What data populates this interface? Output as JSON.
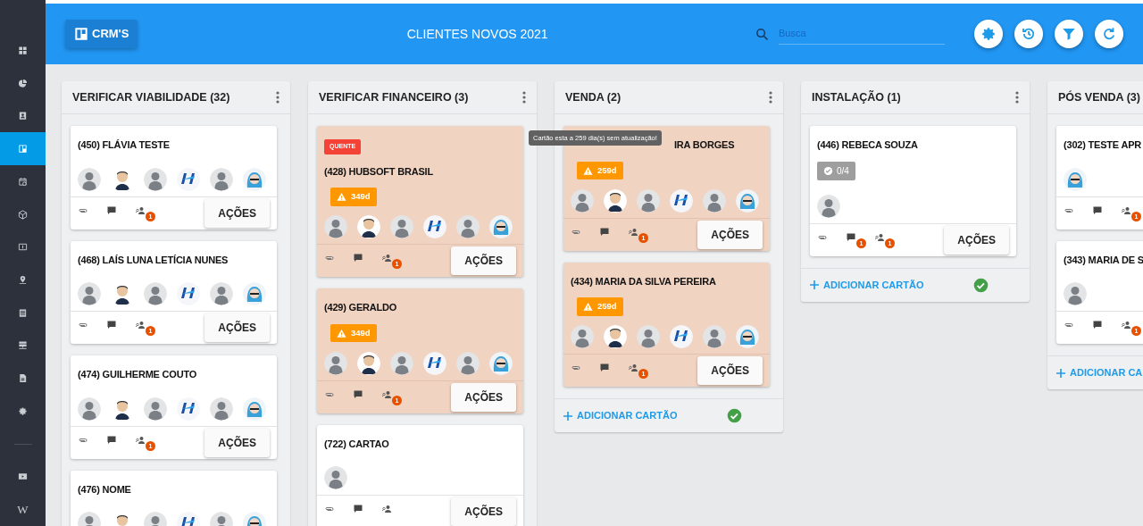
{
  "sidebar": {
    "items": [
      {
        "kind": "grid",
        "selected": false
      },
      {
        "kind": "pie",
        "selected": false
      },
      {
        "kind": "contact",
        "selected": false
      },
      {
        "kind": "board",
        "selected": true
      },
      {
        "kind": "calendar",
        "selected": false
      },
      {
        "kind": "cube",
        "selected": false
      },
      {
        "kind": "money",
        "selected": false
      },
      {
        "kind": "location",
        "selected": false
      },
      {
        "kind": "list",
        "selected": false
      },
      {
        "kind": "server",
        "selected": false
      },
      {
        "kind": "document",
        "selected": false
      },
      {
        "kind": "gear",
        "selected": false
      },
      {
        "kind": "divider"
      },
      {
        "kind": "video",
        "selected": false
      },
      {
        "kind": "letter",
        "text": "W",
        "selected": false
      }
    ]
  },
  "header": {
    "button": "CRM'S",
    "title": "CLIENTES NOVOS 2021",
    "search": {
      "placeholder": "Busca"
    },
    "actions": [
      {
        "kind": "settings"
      },
      {
        "kind": "history"
      },
      {
        "kind": "filter"
      },
      {
        "kind": "refresh"
      }
    ]
  },
  "columns": [
    {
      "title": "VERIFICAR VIABILIDADE (32)",
      "menu": true,
      "cards": [
        {
          "title": "(450) FLÁVIA TESTE",
          "stale": false,
          "avatars": [
            {
              "kind": "silhouette"
            },
            {
              "kind": "man"
            },
            {
              "kind": "silhouette"
            },
            {
              "kind": "logo"
            },
            {
              "kind": "silhouette"
            },
            {
              "kind": "woman"
            }
          ],
          "people_count": "1",
          "button": "AÇÕES"
        },
        {
          "title": "(468) LAÍS LUNA LETÍCIA NUNES",
          "stale": false,
          "avatars": [
            {
              "kind": "silhouette"
            },
            {
              "kind": "man"
            },
            {
              "kind": "silhouette"
            },
            {
              "kind": "logo"
            },
            {
              "kind": "silhouette"
            },
            {
              "kind": "woman"
            }
          ],
          "people_count": "1",
          "button": "AÇÕES"
        },
        {
          "title": "(474) GUILHERME COUTO",
          "stale": false,
          "avatars": [
            {
              "kind": "silhouette"
            },
            {
              "kind": "man"
            },
            {
              "kind": "silhouette"
            },
            {
              "kind": "logo"
            },
            {
              "kind": "silhouette"
            },
            {
              "kind": "woman"
            }
          ],
          "people_count": "1",
          "button": "AÇÕES"
        },
        {
          "title": "(476) NOME",
          "stale": false,
          "avatars": [
            {
              "kind": "silhouette"
            },
            {
              "kind": "man"
            },
            {
              "kind": "silhouette"
            },
            {
              "kind": "logo"
            },
            {
              "kind": "silhouette"
            },
            {
              "kind": "woman"
            }
          ]
        }
      ]
    },
    {
      "title": "VERIFICAR FINANCEIRO (3)",
      "menu": true,
      "cards": [
        {
          "tag": "QUENTE",
          "title": "(428) HUBSOFT BRASIL",
          "stale": true,
          "warning": "349d",
          "avatars": [
            {
              "kind": "silhouette"
            },
            {
              "kind": "man"
            },
            {
              "kind": "silhouette"
            },
            {
              "kind": "logo"
            },
            {
              "kind": "silhouette"
            },
            {
              "kind": "woman"
            }
          ],
          "people_count": "1",
          "button": "AÇÕES"
        },
        {
          "title": "(429) GERALDO",
          "stale": true,
          "warning": "349d",
          "avatars": [
            {
              "kind": "silhouette"
            },
            {
              "kind": "man"
            },
            {
              "kind": "silhouette"
            },
            {
              "kind": "logo"
            },
            {
              "kind": "silhouette"
            },
            {
              "kind": "woman"
            }
          ],
          "people_count": "1",
          "button": "AÇÕES"
        },
        {
          "title": "(722) CARTAO",
          "stale": false,
          "avatars": [
            {
              "kind": "silhouette"
            }
          ],
          "button": "AÇÕES"
        }
      ]
    },
    {
      "title": "VENDA (2)",
      "menu": true,
      "cards": [
        {
          "title": "IRA BORGES",
          "tooltip": "Cartão esta a 259 dia(s) sem atualização!",
          "stale": true,
          "warning": "259d",
          "avatars": [
            {
              "kind": "silhouette"
            },
            {
              "kind": "man"
            },
            {
              "kind": "silhouette"
            },
            {
              "kind": "logo"
            },
            {
              "kind": "silhouette"
            },
            {
              "kind": "woman"
            }
          ],
          "people_count": "1",
          "button": "AÇÕES"
        },
        {
          "title": "(434) MARIA DA SILVA PEREIRA",
          "stale": true,
          "warning": "259d",
          "avatars": [
            {
              "kind": "silhouette"
            },
            {
              "kind": "man"
            },
            {
              "kind": "silhouette"
            },
            {
              "kind": "logo"
            },
            {
              "kind": "silhouette"
            },
            {
              "kind": "woman"
            }
          ],
          "people_count": "1",
          "button": "AÇÕES"
        }
      ],
      "footer": {
        "label": "ADICIONAR CARTÃO",
        "done": true
      }
    },
    {
      "title": "INSTALAÇÃO (1)",
      "menu": true,
      "cards": [
        {
          "title": "(446) REBECA SOUZA",
          "stale": false,
          "checklist": "0/4",
          "avatars": [
            {
              "kind": "silhouette"
            }
          ],
          "comment_count": "1",
          "people_count": "1",
          "button": "AÇÕES"
        }
      ],
      "footer": {
        "label": "ADICIONAR CARTÃO",
        "done": true
      }
    },
    {
      "title": "PÓS VENDA (3)",
      "menu": false,
      "cards": [
        {
          "title": "(302) TESTE APR",
          "stale": false,
          "avatars": [
            {
              "kind": "woman"
            }
          ],
          "people_count": "1"
        },
        {
          "title": "(343) MARIA DE S",
          "stale": false,
          "avatars": [
            {
              "kind": "silhouette"
            }
          ],
          "people_count": "1"
        }
      ],
      "footer": {
        "label": "ADICIONAR CA",
        "done": false
      }
    }
  ]
}
